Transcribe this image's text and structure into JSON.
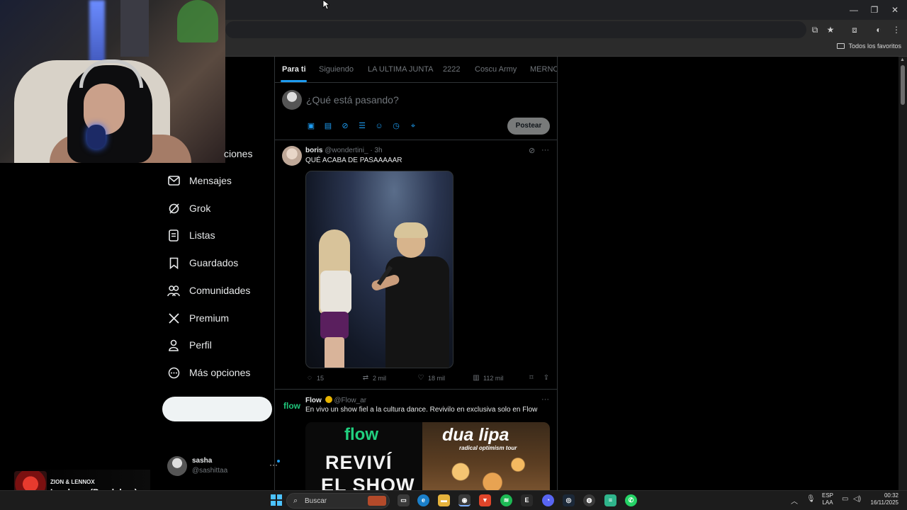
{
  "browser": {
    "window_controls": [
      "—",
      "❐",
      "✕"
    ],
    "bookmarks_folder": "Todos los favoritos"
  },
  "nav": {
    "items": [
      {
        "label": "Mensajes",
        "icon": "envelope-icon"
      },
      {
        "label": "Grok",
        "icon": "grok-icon"
      },
      {
        "label": "Listas",
        "icon": "list-icon"
      },
      {
        "label": "Guardados",
        "icon": "bookmark-icon"
      },
      {
        "label": "Comunidades",
        "icon": "communities-icon"
      },
      {
        "label": "Premium",
        "icon": "x-logo-icon"
      },
      {
        "label": "Perfil",
        "icon": "person-icon"
      },
      {
        "label": "Más opciones",
        "icon": "more-circle-icon"
      }
    ],
    "partial_label": "ciones",
    "account": {
      "name": "sasha",
      "handle": "@sashittaa"
    }
  },
  "feed": {
    "tabs": [
      "Para ti",
      "Siguiendo",
      "LA ULTIMA JUNTA",
      "2222",
      "Coscu Army",
      "MERNOS"
    ],
    "active_tab": 0,
    "composer": {
      "placeholder": "¿Qué está pasando?",
      "post_label": "Postear"
    },
    "tweets": [
      {
        "name": "boris",
        "handle": "@wondertini_",
        "time": "· 3h",
        "text": "QUÉ ACABA DE PASAAAAAR",
        "stats": {
          "replies": "15",
          "reposts": "2 mil",
          "likes": "18 mil",
          "views": "112 mil"
        }
      },
      {
        "logo": "flow",
        "name": "Flow",
        "handle": "@Flow_ar",
        "text": "En vivo un show fiel a la cultura dance. Revivilo en exclusiva solo en Flow",
        "ad": {
          "left_logo": "flow",
          "left_line1": "REVIVÍ",
          "left_line2": "EL SHOW",
          "right_title": "dua lipa",
          "right_subtitle": "radical optimism tour"
        }
      }
    ]
  },
  "now_playing": {
    "artist": "ZION & LENNOX",
    "title": "La player (Bandolera)"
  },
  "taskbar": {
    "search_label": "Buscar",
    "lang_line1": "ESP",
    "lang_line2": "LAA",
    "time": "00:32",
    "date": "16/11/2025"
  }
}
